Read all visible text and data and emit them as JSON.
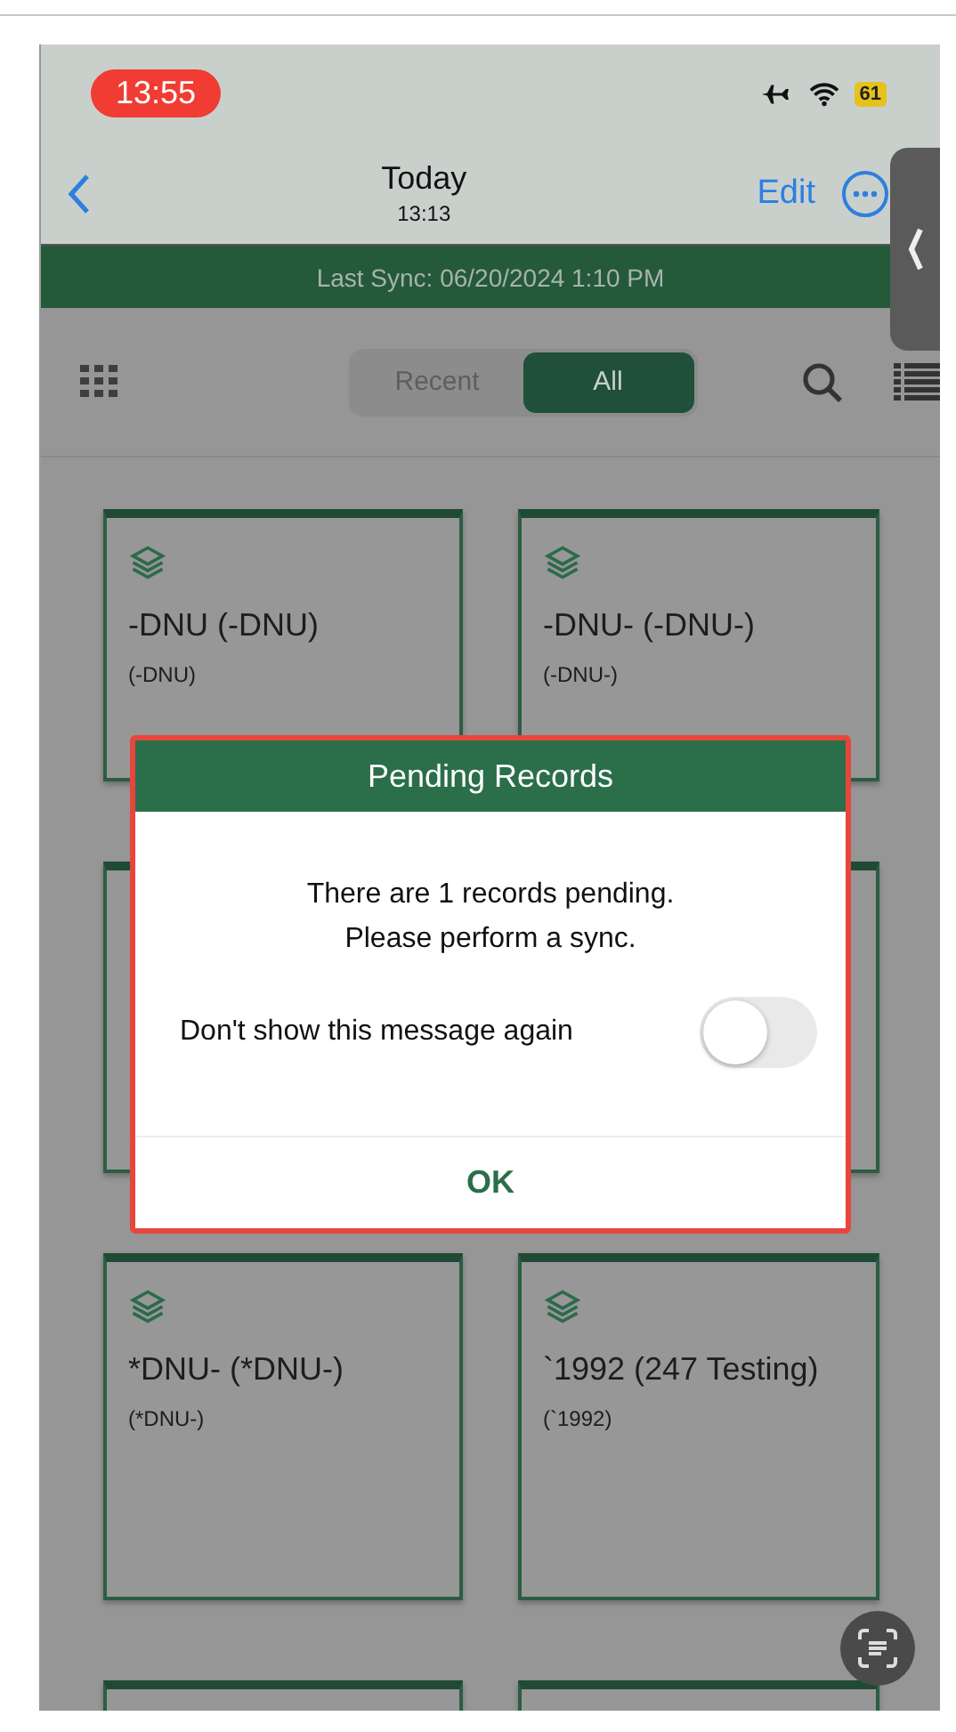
{
  "status_bar": {
    "time": "13:55",
    "battery": "61"
  },
  "nav": {
    "title": "Today",
    "subtitle": "13:13",
    "edit": "Edit"
  },
  "sync_bar": {
    "text": "Last Sync: 06/20/2024 1:10 PM"
  },
  "segments": [
    {
      "label": "Recent",
      "selected": false
    },
    {
      "label": "All",
      "selected": true
    }
  ],
  "cards": [
    {
      "title": "-DNU (-DNU)",
      "subtitle": "(-DNU)"
    },
    {
      "title": "-DNU- (-DNU-)",
      "subtitle": "(-DNU-)"
    },
    {
      "title": "*DNU- (*DNU-)",
      "subtitle": "(*DNU-)"
    },
    {
      "title": "`1992 (247 Testing)",
      "subtitle": "(`1992)"
    }
  ],
  "dialog": {
    "title": "Pending Records",
    "message": "There are 1 records pending.\nPlease perform a sync.",
    "toggle": {
      "label": "Don't show this message again",
      "on": false
    },
    "button": "OK"
  }
}
